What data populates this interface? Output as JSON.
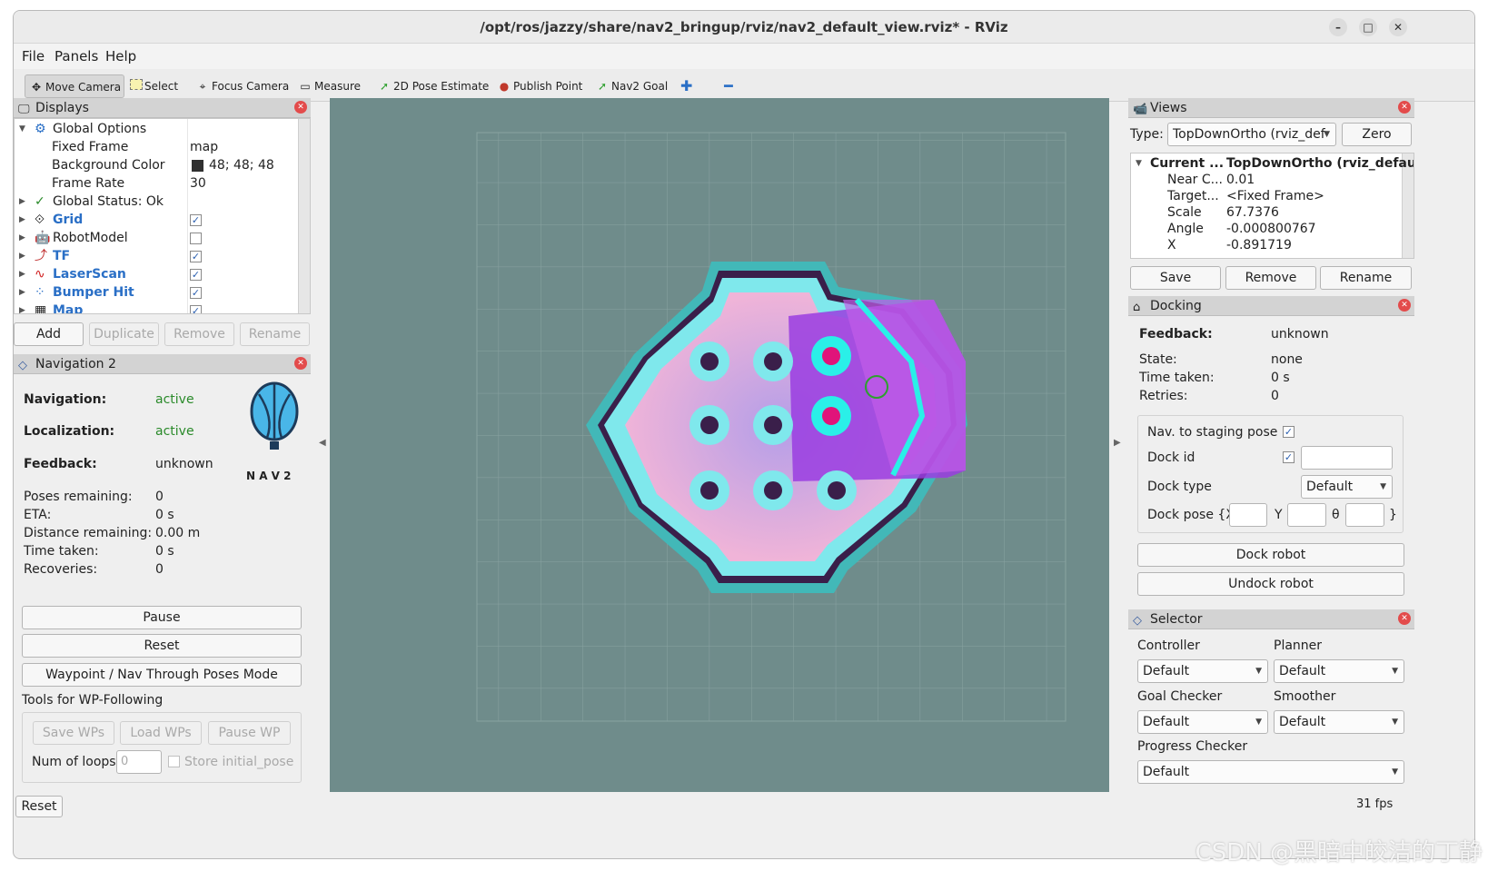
{
  "window": {
    "title": "/opt/ros/jazzy/share/nav2_bringup/rviz/nav2_default_view.rviz* - RViz",
    "min": "–",
    "max": "□",
    "close": "✕"
  },
  "menu": [
    "File",
    "Panels",
    "Help"
  ],
  "toolbar": [
    {
      "label": "Move Camera",
      "icon": "move-camera-icon"
    },
    {
      "label": "Select",
      "icon": "select-icon"
    },
    {
      "label": "Focus Camera",
      "icon": "focus-camera-icon"
    },
    {
      "label": "Measure",
      "icon": "measure-icon"
    },
    {
      "label": "2D Pose Estimate",
      "icon": "pose-estimate-icon"
    },
    {
      "label": "Publish Point",
      "icon": "publish-point-icon"
    },
    {
      "label": "Nav2 Goal",
      "icon": "nav2-goal-icon"
    }
  ],
  "displays": {
    "title": "Displays",
    "rows": [
      {
        "label": "Global Options",
        "value": ""
      },
      {
        "label": "Fixed Frame",
        "value": "map"
      },
      {
        "label": "Background Color",
        "value": "48; 48; 48"
      },
      {
        "label": "Frame Rate",
        "value": "30"
      },
      {
        "label": "Global Status: Ok",
        "value": ""
      },
      {
        "label": "Grid",
        "value": ""
      },
      {
        "label": "RobotModel",
        "value": ""
      },
      {
        "label": "TF",
        "value": ""
      },
      {
        "label": "LaserScan",
        "value": ""
      },
      {
        "label": "Bumper Hit",
        "value": ""
      },
      {
        "label": "Map",
        "value": ""
      }
    ],
    "buttons": [
      "Add",
      "Duplicate",
      "Remove",
      "Rename"
    ]
  },
  "navigation": {
    "title": "Navigation 2",
    "nav_label": "Navigation:",
    "nav_value": "active",
    "loc_label": "Localization:",
    "loc_value": "active",
    "fb_label": "Feedback:",
    "fb_value": "unknown",
    "logo_text": "N A V 2",
    "stats": [
      {
        "label": "Poses remaining:",
        "value": "0"
      },
      {
        "label": "ETA:",
        "value": "0 s"
      },
      {
        "label": "Distance remaining:",
        "value": "0.00 m"
      },
      {
        "label": "Time taken:",
        "value": "0 s"
      },
      {
        "label": "Recoveries:",
        "value": "0"
      }
    ],
    "pause": "Pause",
    "reset": "Reset",
    "waypoint": "Waypoint / Nav Through Poses Mode",
    "wp_tools": "Tools for WP-Following",
    "save_wps": "Save WPs",
    "load_wps": "Load WPs",
    "pause_wp": "Pause WP",
    "num_loops": "Num of loops",
    "num_loops_value": "0",
    "store_initial": "Store initial_pose"
  },
  "views": {
    "title": "Views",
    "type_label": "Type:",
    "type_value": "TopDownOrtho (rviz_def",
    "zero": "Zero",
    "rows": [
      {
        "label": "Current ...",
        "value": "TopDownOrtho (rviz_defaul."
      },
      {
        "label": "Near C...",
        "value": "0.01"
      },
      {
        "label": "Target...",
        "value": "<Fixed Frame>"
      },
      {
        "label": "Scale",
        "value": "67.7376"
      },
      {
        "label": "Angle",
        "value": "-0.000800767"
      },
      {
        "label": "X",
        "value": "-0.891719"
      }
    ],
    "save": "Save",
    "remove": "Remove",
    "rename": "Rename"
  },
  "docking": {
    "title": "Docking",
    "fb_label": "Feedback:",
    "fb_value": "unknown",
    "state_label": "State:",
    "state_value": "none",
    "time_label": "Time taken:",
    "time_value": "0 s",
    "retries_label": "Retries:",
    "retries_value": "0",
    "staging": "Nav. to staging pose",
    "dock_id": "Dock id",
    "dock_type": "Dock type",
    "dock_type_value": "Default",
    "dock_pose": "Dock pose {X",
    "y": "Y",
    "theta": "θ",
    "brace": "}",
    "dock_robot": "Dock robot",
    "undock_robot": "Undock robot"
  },
  "selector": {
    "title": "Selector",
    "controller": "Controller",
    "planner": "Planner",
    "goal_checker": "Goal Checker",
    "smoother": "Smoother",
    "progress_checker": "Progress Checker",
    "default": "Default"
  },
  "status": {
    "reset": "Reset",
    "fps": "31 fps",
    "watermark": "CSDN @黑暗中皎洁的丁静"
  },
  "colors": {
    "viewport": "#6f8c8b",
    "accent": "#2a6fc6",
    "active": "#2a8a2a"
  }
}
